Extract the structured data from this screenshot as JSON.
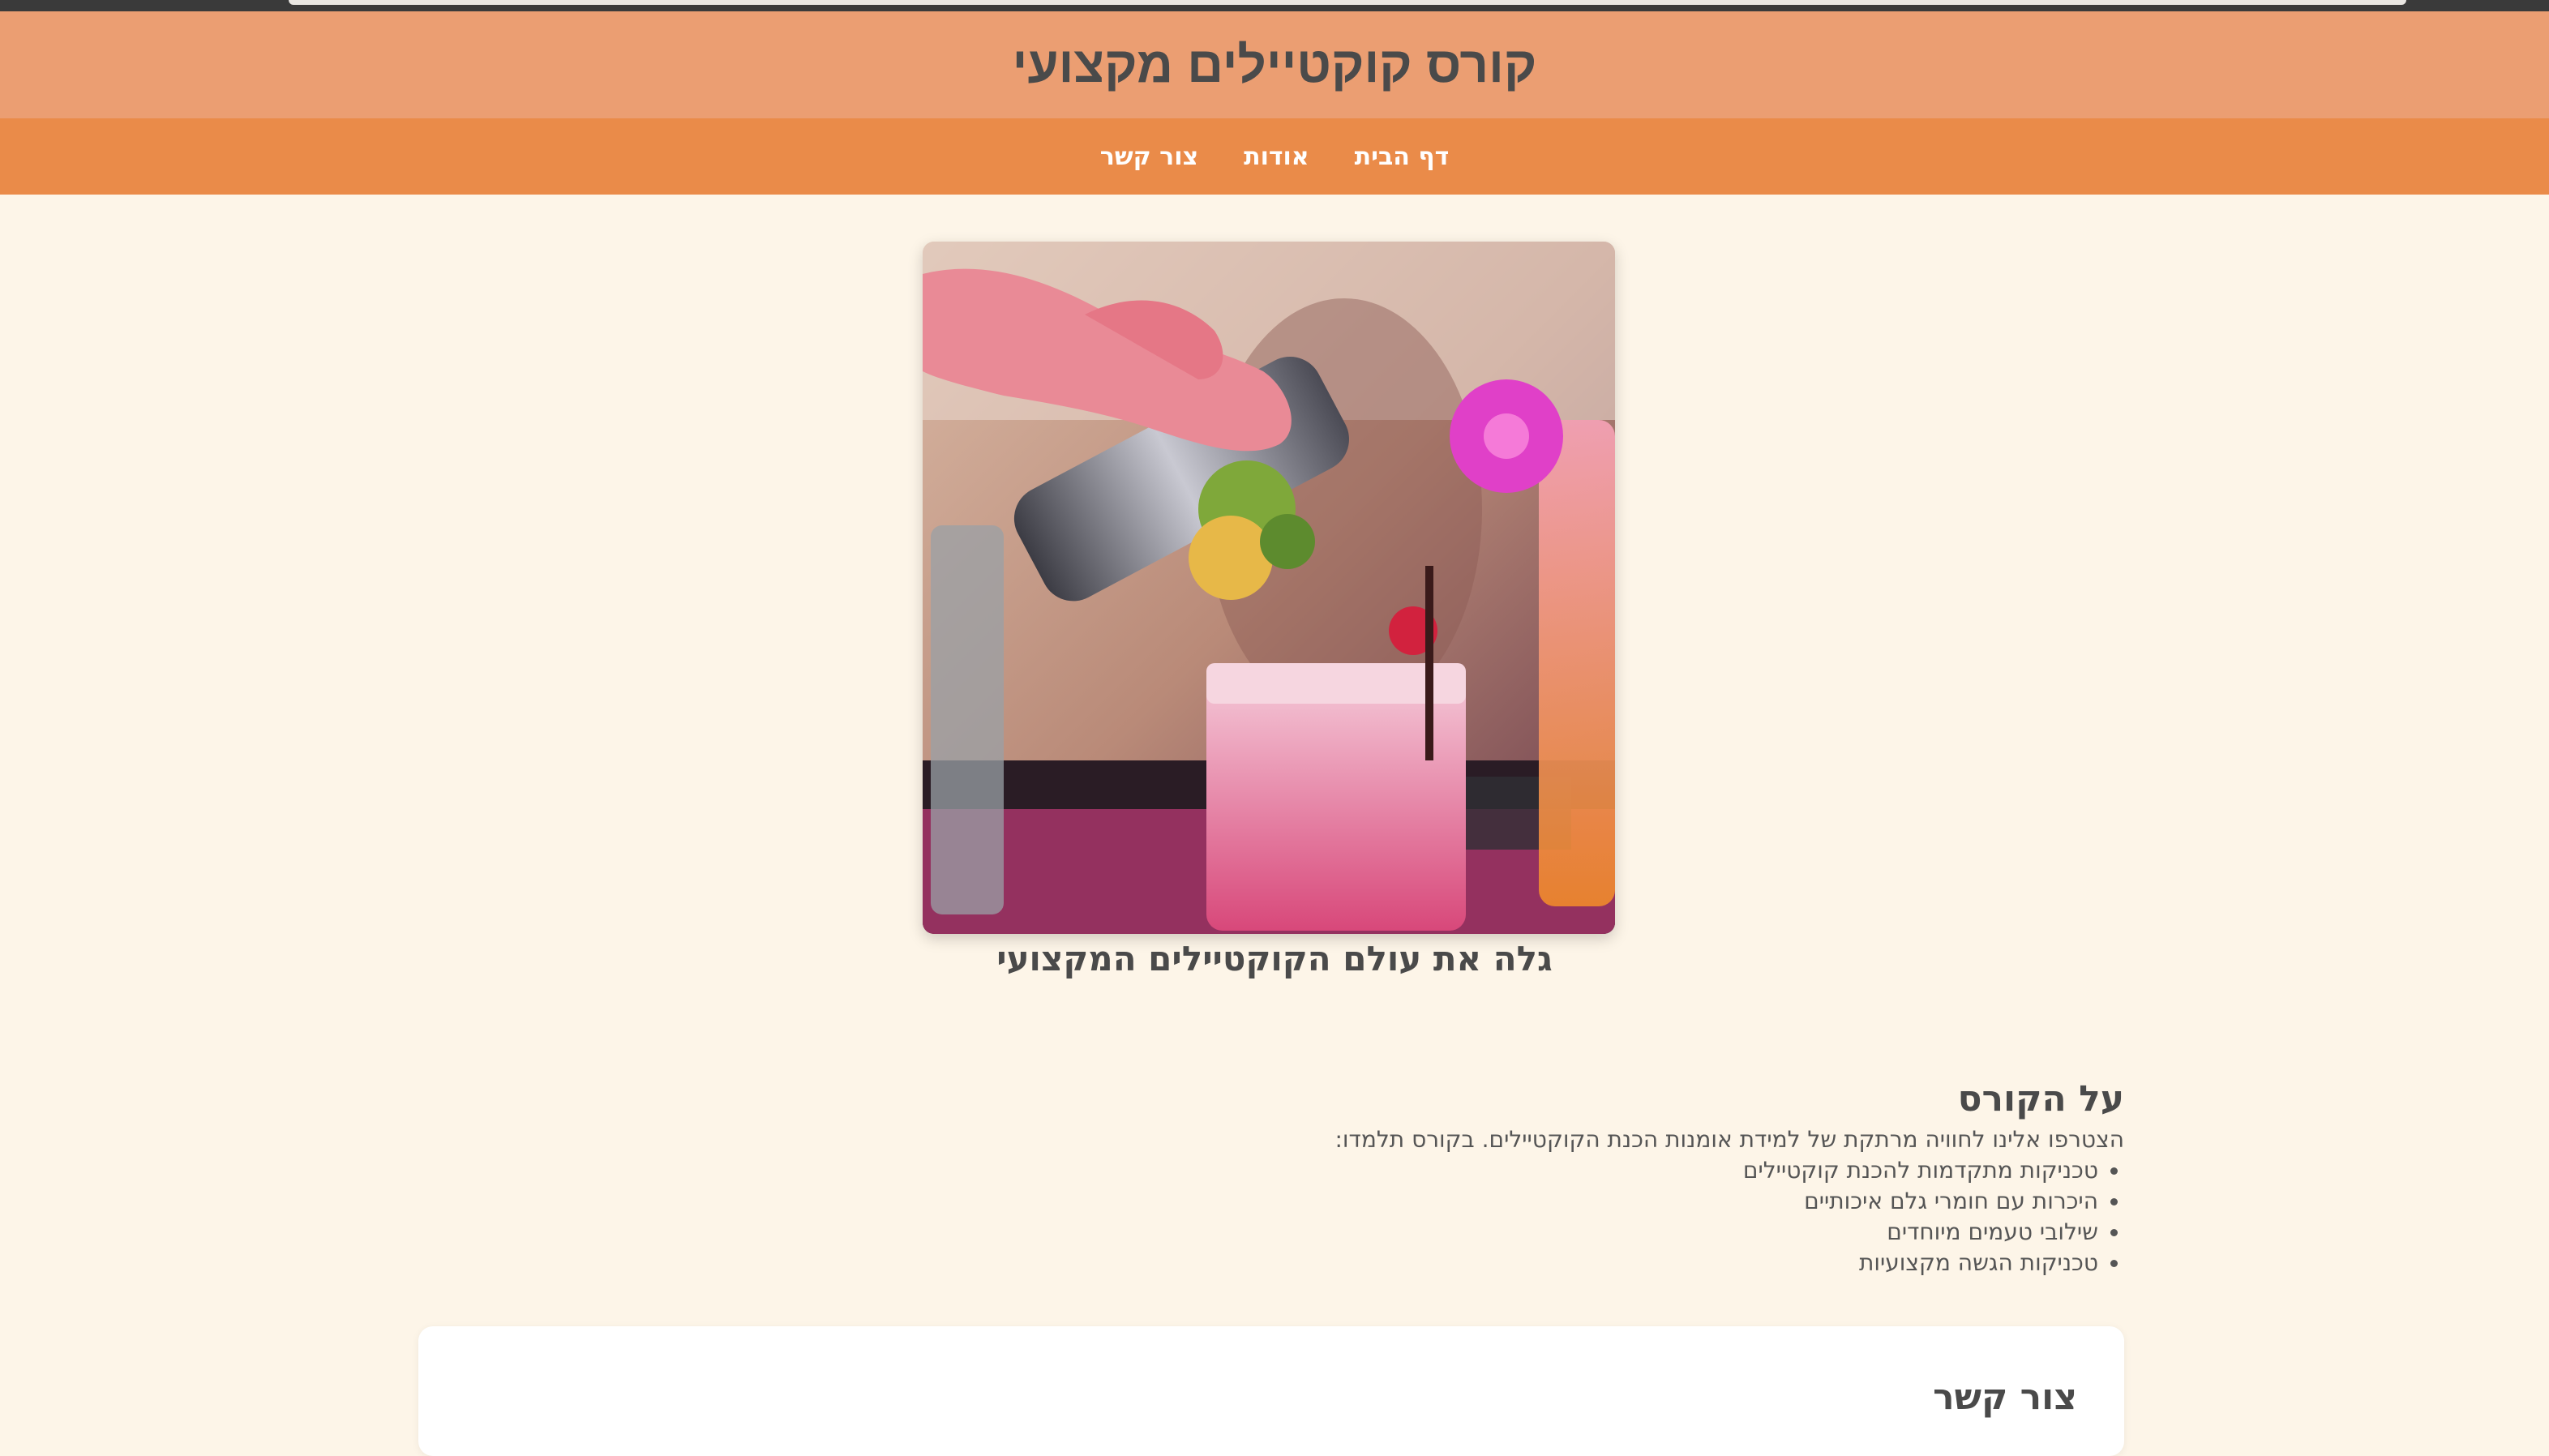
{
  "header": {
    "title": "קורס קוקטיילים מקצועי"
  },
  "nav": {
    "items": [
      {
        "label": "דף הבית"
      },
      {
        "label": "אודות"
      },
      {
        "label": "צור קשר"
      }
    ]
  },
  "hero": {
    "caption": "גלה את עולם הקוקטיילים המקצועי",
    "image_subject": "bartender pouring cocktail from shaker"
  },
  "about": {
    "title": "על הקורס",
    "intro": "הצטרפו אלינו לחוויה מרתקת של למידת אומנות הכנת הקוקטיילים. בקורס תלמדו:",
    "items": [
      "טכניקות מתקדמות להכנת קוקטיילים",
      "היכרות עם חומרי גלם איכותיים",
      "שילובי טעמים מיוחדים",
      "טכניקות הגשה מקצועיות"
    ]
  },
  "contact": {
    "title": "צור קשר"
  },
  "colors": {
    "header_bg": "#eb9e72",
    "nav_bg": "#ea8b49",
    "page_bg": "#fdf5e8",
    "text": "#4a4a4a"
  }
}
